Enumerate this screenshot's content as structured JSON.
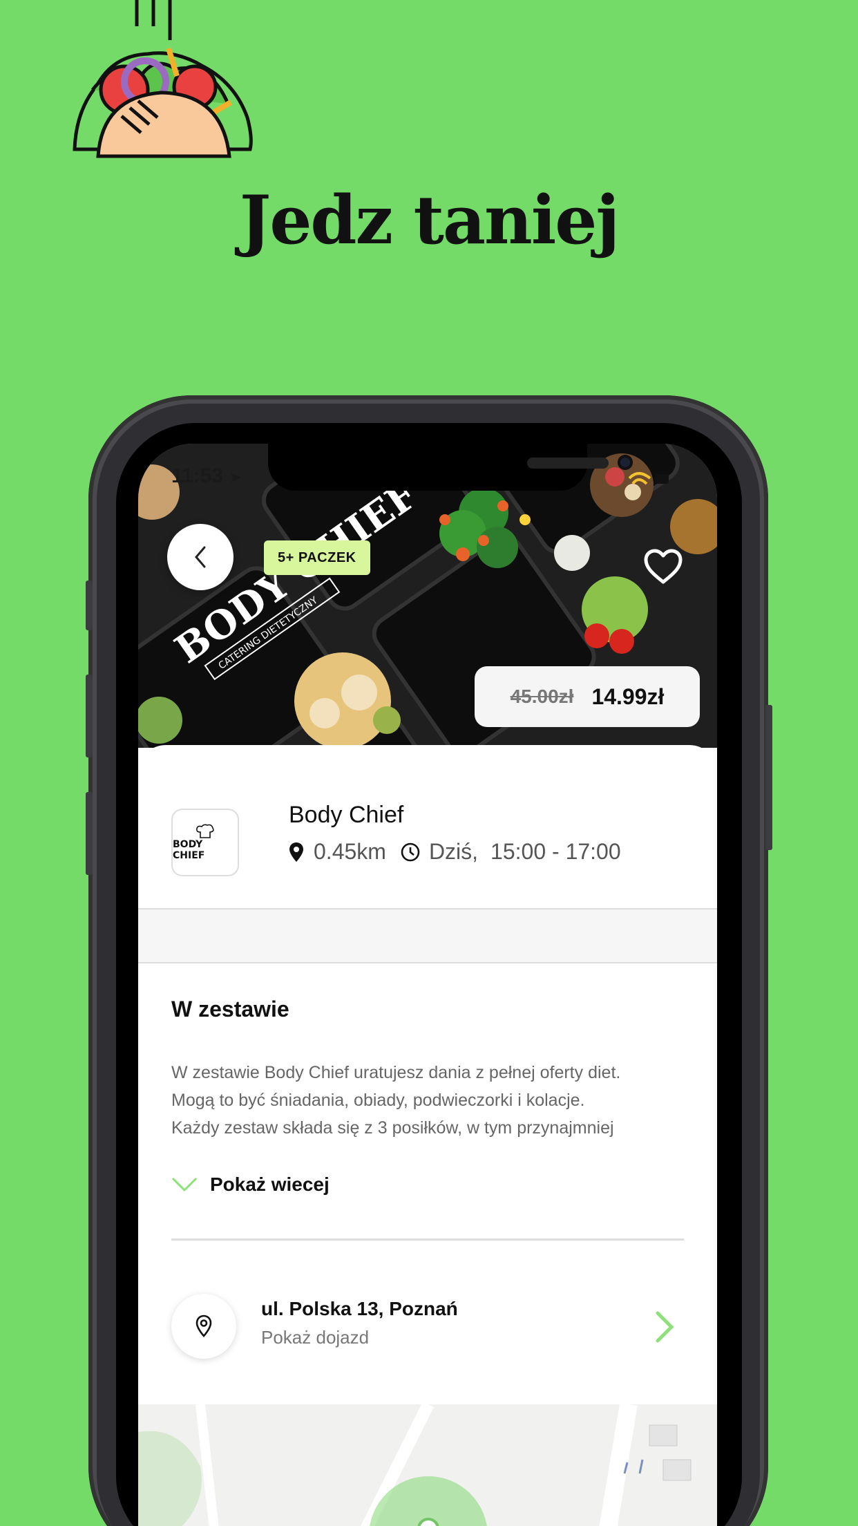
{
  "promo": {
    "headline": "Jedz taniej"
  },
  "status_bar": {
    "time": "11:53"
  },
  "offer": {
    "badge": "5+ PACZEK",
    "old_price": "45.00zł",
    "new_price": "14.99zł",
    "hero_logo_text": "BODY CHIEF",
    "hero_logo_sub": "CATERING DIETETYCZNY"
  },
  "business": {
    "name": "Body Chief",
    "logo_text": "BODY CHIEF",
    "distance": "0.45km",
    "day": "Dziś,",
    "hours": "15:00 - 17:00"
  },
  "details": {
    "section_title": "W zestawie",
    "description_lines": [
      "W zestawie Body Chief uratujesz dania z pełnej oferty diet.",
      "Mogą to być śniadania, obiady, podwieczorki i kolacje.",
      "Każdy zestaw składa się z 3 posiłków, w tym przynajmniej"
    ],
    "show_more": "Pokaż wiecej"
  },
  "address": {
    "line": "ul. Polska 13, Poznań",
    "action": "Pokaż dojazd"
  },
  "colors": {
    "background": "#74DB68",
    "badge": "#D8F79C",
    "accent_chevron": "#8EE07A"
  }
}
